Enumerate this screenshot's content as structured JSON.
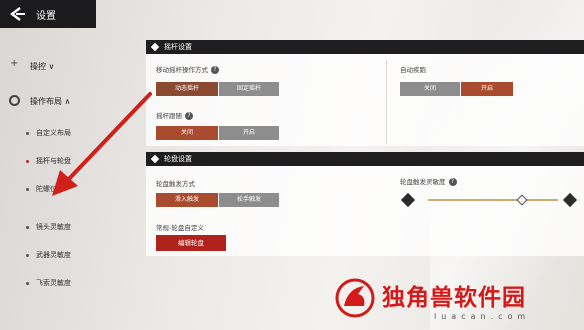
{
  "header": {
    "title": "设置"
  },
  "sidebar": {
    "items": [
      {
        "label": "操控",
        "suffix": "∨"
      },
      {
        "label": "操作布局",
        "suffix": "∧"
      },
      {
        "label": "自定义布局"
      },
      {
        "label": "摇杆与轮盘"
      },
      {
        "label": "陀螺仪"
      },
      {
        "label": "镜头灵敏度"
      },
      {
        "label": "武器灵敏度"
      },
      {
        "label": "飞索灵敏度"
      }
    ]
  },
  "joystick": {
    "title": "摇杆设置",
    "move_label": "移动摇杆操作方式",
    "move_options": [
      "动态摇杆",
      "固定摇杆"
    ],
    "auto_run_label": "自动疾跑",
    "auto_run_options": [
      "关闭",
      "开启"
    ],
    "third_label": "摇杆跟随",
    "third_options": [
      "关闭",
      "开启"
    ]
  },
  "wheel": {
    "title": "轮盘设置",
    "trigger_label": "轮盘触发方式",
    "trigger_options": [
      "滑入触发",
      "松手触发"
    ],
    "sensitivity_label": "轮盘触发灵敏度",
    "sensitivity_value": 0.72,
    "custom_label": "常规-轮盘自定义",
    "edit_label": "编辑轮盘"
  },
  "watermark": {
    "text": "独角兽软件园",
    "url": "luacan.com"
  }
}
